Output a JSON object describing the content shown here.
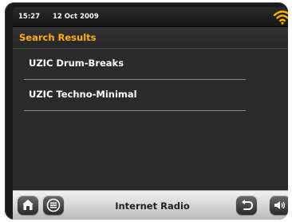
{
  "status": {
    "time": "15:27",
    "date": "12 Oct  2009",
    "wifi_icon": "wifi-icon"
  },
  "header": {
    "title": "Search Results"
  },
  "results": [
    {
      "label": "UZIC Drum-Breaks"
    },
    {
      "label": "UZIC Techno-Minimal"
    }
  ],
  "bottom": {
    "title": "Internet Radio",
    "buttons": [
      "home-icon",
      "menu-icon",
      "back-icon",
      "volume-icon"
    ]
  },
  "colors": {
    "accent": "#ffb000",
    "wifi": "#ffb000"
  }
}
